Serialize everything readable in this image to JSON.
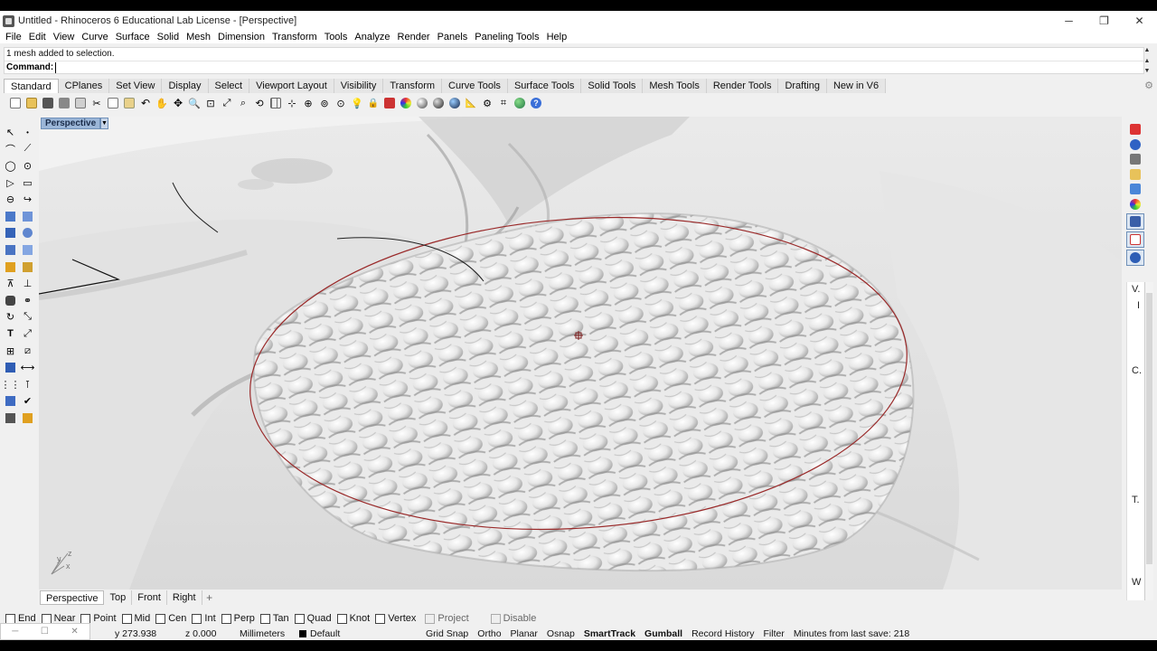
{
  "window": {
    "title": "Untitled - Rhinoceros 6 Educational Lab License - [Perspective]",
    "minimize": "─",
    "restore": "❐",
    "close": "✕"
  },
  "menu": [
    "File",
    "Edit",
    "View",
    "Curve",
    "Surface",
    "Solid",
    "Mesh",
    "Dimension",
    "Transform",
    "Tools",
    "Analyze",
    "Render",
    "Panels",
    "Paneling Tools",
    "Help"
  ],
  "command": {
    "history": "1 mesh added to selection.",
    "label": "Command:",
    "value": ""
  },
  "tabs": [
    "Standard",
    "CPlanes",
    "Set View",
    "Display",
    "Select",
    "Viewport Layout",
    "Visibility",
    "Transform",
    "Curve Tools",
    "Surface Tools",
    "Solid Tools",
    "Mesh Tools",
    "Render Tools",
    "Drafting",
    "New in V6"
  ],
  "active_tab": "Standard",
  "viewport": {
    "name": "Perspective",
    "axis_x": "x",
    "axis_y": "y",
    "axis_z": "z"
  },
  "viewport_tabs": [
    "Perspective",
    "Top",
    "Front",
    "Right"
  ],
  "osnaps": [
    {
      "label": "End",
      "checked": false
    },
    {
      "label": "Near",
      "checked": false
    },
    {
      "label": "Point",
      "checked": false
    },
    {
      "label": "Mid",
      "checked": false
    },
    {
      "label": "Cen",
      "checked": false
    },
    {
      "label": "Int",
      "checked": false
    },
    {
      "label": "Perp",
      "checked": false
    },
    {
      "label": "Tan",
      "checked": false
    },
    {
      "label": "Quad",
      "checked": false
    },
    {
      "label": "Knot",
      "checked": false
    },
    {
      "label": "Vertex",
      "checked": false
    },
    {
      "label": "Project",
      "checked": false,
      "disabled": true
    },
    {
      "label": "Disable",
      "checked": false,
      "disabled": true
    }
  ],
  "status": {
    "y": "y 273.938",
    "z": "z 0.000",
    "units": "Millimeters",
    "layer": "Default",
    "grid_snap": "Grid Snap",
    "ortho": "Ortho",
    "planar": "Planar",
    "osnap": "Osnap",
    "smarttrack": "SmartTrack",
    "gumball": "Gumball",
    "record_history": "Record History",
    "filter": "Filter",
    "save_info": "Minutes from last save: 218"
  },
  "right_panel_text": [
    "V.",
    "I",
    "C.",
    "T.",
    "W"
  ],
  "colors": {
    "curve_red": "#9a2a2a",
    "viewport_label_bg": "#9bb6d8",
    "terrain": "#e4e4e4"
  }
}
